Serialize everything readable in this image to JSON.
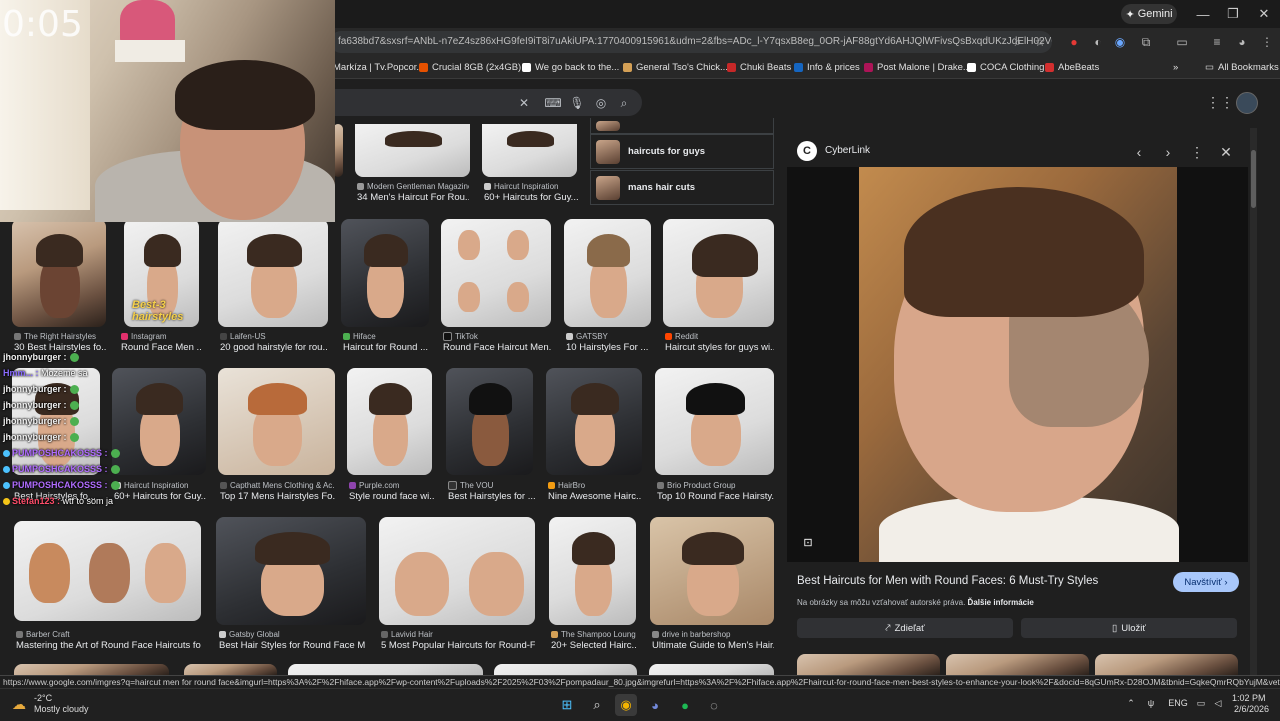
{
  "browser": {
    "url": "fa638bd7&sxsrf=ANbL-n7eZ4sz86xHG9feI9iT8i7uAkiUPA:1770400915961&udm=2&fbs=ADc_l-Y7qsxB8eg_0OR-jAF88gtYd6AHJQlWFivsQsBxqdUKzJdElH02VCvo...",
    "gemini_label": "Gemini",
    "bookmarks": [
      {
        "label": "Markíza | Tv.Popcor...",
        "color": "#e53935"
      },
      {
        "label": "Crucial 8GB (2x4GB)...",
        "color": "#e65100"
      },
      {
        "label": "We go back to the...",
        "color": "#ffffff"
      },
      {
        "label": "General Tso's Chick...",
        "color": "#d4a056"
      },
      {
        "label": "Chuki Beats",
        "color": "#c62828"
      },
      {
        "label": "Info & prices",
        "color": "#1565c0"
      },
      {
        "label": "Post Malone | Drake...",
        "color": "#ad1457"
      },
      {
        "label": "COCA Clothing",
        "color": "#ffffff"
      },
      {
        "label": "AbeBeats",
        "color": "#d32f2f"
      }
    ],
    "more_bookmarks": "»",
    "all_bookmarks": "All Bookmarks",
    "status_url": "https://www.google.com/imgres?q=haircut men for round face&imgurl=https%3A%2F%2Fhiface.app%2Fwp-content%2Fuploads%2F2025%2F03%2Fpompadaur_80.jpg&imgrefurl=https%3A%2F%2Fhiface.app%2Fhaircut-for-round-face-men-best-styles-to-enhance-your-look%2F&docid=8qGUmRx-D28OJM&tbnid=GqkeQmrRQbYujM&vet=12ahUKEwj..."
  },
  "related": [
    {
      "label": "haircuts for guys"
    },
    {
      "label": "mans hair cuts"
    }
  ],
  "top_results": [
    {
      "source": "Modern Gentleman Magazine",
      "title": "34 Men's Haircut For Rou..."
    },
    {
      "source": "Haircut Inspiration",
      "title": "60+ Haircuts for Guy..."
    }
  ],
  "row1": [
    {
      "source": "The Right Hairstyles",
      "title": "30 Best Hairstyles fo..."
    },
    {
      "source": "Instagram",
      "title": "Round Face Men ...",
      "overlay": "Best-3 hairstyles"
    },
    {
      "source": "Laifen-US",
      "title": "20 good hairstyle for rou..."
    },
    {
      "source": "Hiface",
      "title": "Haircut for Round ..."
    },
    {
      "source": "TikTok",
      "title": "Round Face Haircut Men..."
    },
    {
      "source": "GATSBY",
      "title": "10 Hairstyles For ..."
    },
    {
      "source": "Reddit",
      "title": "Haircut styles for guys wi..."
    }
  ],
  "row2": [
    {
      "source": "",
      "title": "Best Hairstyles fo..."
    },
    {
      "source": "Haircut Inspiration",
      "title": "60+ Haircuts for Guy..."
    },
    {
      "source": "Capthatt Mens Clothing & Ac...",
      "title": "Top 17 Mens Hairstyles Fo..."
    },
    {
      "source": "Purple.com",
      "title": "Style round face wi..."
    },
    {
      "source": "The VOU",
      "title": "Best Hairstyles for ..."
    },
    {
      "source": "HairBro",
      "title": "Nine Awesome Hairc..."
    },
    {
      "source": "Brio Product Group",
      "title": "Top 10 Round Face Hairsty..."
    }
  ],
  "row3": [
    {
      "source": "Barber Craft",
      "title": "Mastering the Art of Round Face Haircuts for ..."
    },
    {
      "source": "Gatsby Global",
      "title": "Best Hair Styles for Round Face M..."
    },
    {
      "source": "Lavivid Hair",
      "title": "5 Most Popular Haircuts for Round-F..."
    },
    {
      "source": "The Shampoo Lounge",
      "title": "20+ Selected Hairc..."
    },
    {
      "source": "drive in barbershop",
      "title": "Ultimate Guide to Men's Hair..."
    }
  ],
  "panel": {
    "logo_letter": "C",
    "source": "CyberLink",
    "title": "Best Haircuts for Men with Round Faces: 6 Must-Try Styles",
    "visit_label": "Navštíviť",
    "copyright_text": "Na obrázky sa môžu vzťahovať autorské práva.",
    "learn_more": "Ďalšie informácie",
    "share_label": "Zdieľať",
    "save_label": "Uložiť"
  },
  "webcam": {
    "counter": "0:05"
  },
  "chat": [
    {
      "user": "jhonnyburger :",
      "msg": "",
      "color": "#f0f0f0",
      "emote": true
    },
    {
      "user": "Hmm... :",
      "msg": "Mozeme sa",
      "color": "#8a6cff",
      "emote": false
    },
    {
      "user": "jhonnyburger :",
      "msg": "",
      "color": "#f0f0f0",
      "emote": true
    },
    {
      "user": "jhonnyburger :",
      "msg": "",
      "color": "#f0f0f0",
      "emote": true
    },
    {
      "user": "jhonnyburger :",
      "msg": "",
      "color": "#f0f0f0",
      "emote": true
    },
    {
      "user": "jhonnyburger :",
      "msg": "",
      "color": "#f0f0f0",
      "emote": true
    },
    {
      "user": "PUMPOSHCAKOSSS :",
      "msg": "",
      "color": "#b06cff",
      "emote": true
    },
    {
      "user": "PUMPOSHCAKOSSS :",
      "msg": "",
      "color": "#b06cff",
      "emote": true
    },
    {
      "user": "PUMPOSHCAKOSSS :",
      "msg": "",
      "color": "#b06cff",
      "emote": true
    },
    {
      "user": "Stefan123 :",
      "msg": "wtf to som ja",
      "color": "#ff4d6a",
      "emote": false
    }
  ],
  "taskbar": {
    "temp": "-2°C",
    "weather": "Mostly cloudy",
    "lang": "ENG",
    "time": "1:02 PM",
    "date": "2/6/2026"
  },
  "colors": {
    "accent": "#a8c7fa",
    "bg": "#1f1f1f"
  }
}
